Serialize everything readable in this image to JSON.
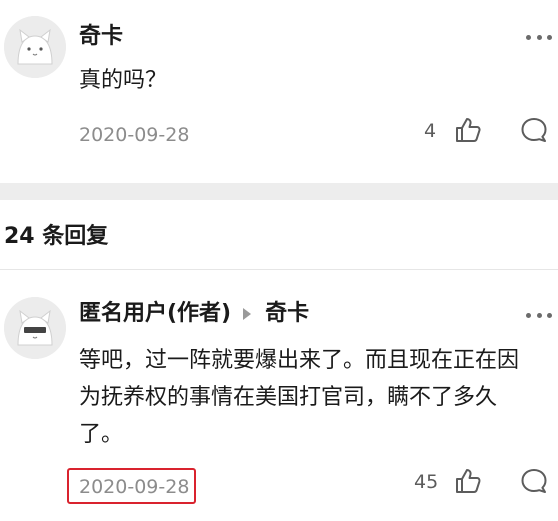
{
  "comments": [
    {
      "author": "奇卡",
      "text": "真的吗？",
      "date": "2020-09-28",
      "likes": "4",
      "icons": {
        "like": "thumbs-up-icon",
        "reply": "comment-bubble-icon",
        "more": "more-dots-icon"
      }
    },
    {
      "author": "匿名用户(作者)",
      "reply_to": "奇卡",
      "text": "等吧，过一阵就要爆出来了。而且现在正在因为抚养权的事情在美国打官司，瞒不了多久了。",
      "date": "2020-09-28",
      "likes": "45",
      "icons": {
        "like": "thumbs-up-icon",
        "reply": "comment-bubble-icon",
        "more": "more-dots-icon",
        "reply_arrow": "reply-arrow-icon"
      }
    }
  ],
  "replies_header": {
    "label": "24 条回复"
  },
  "colors": {
    "highlight": "#d9232e",
    "separator": "#ededed",
    "meta_text": "#8c8c8c"
  }
}
